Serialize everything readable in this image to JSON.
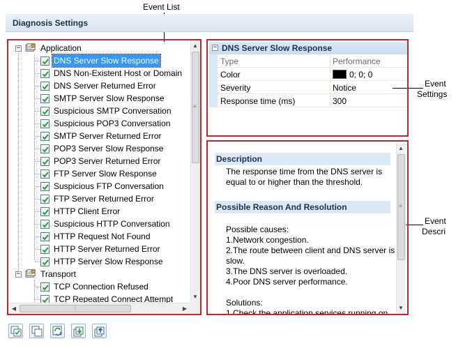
{
  "callouts": {
    "event_list": "Event List",
    "event_settings_line1": "Event",
    "event_settings_line2": "Settings",
    "event_descri_line1": "Event",
    "event_descri_line2": "Descri"
  },
  "header": {
    "title": "Diagnosis Settings"
  },
  "tree": {
    "groups": [
      {
        "label": "Application",
        "items": [
          "DNS Server Slow Response",
          "DNS Non-Existent Host or Domain",
          "DNS Server Returned Error",
          "SMTP Server Slow Response",
          "Suspicious SMTP Conversation",
          "Suspicious POP3 Conversation",
          "SMTP Server Returned Error",
          "POP3 Server Slow Response",
          "POP3 Server Returned Error",
          "FTP Server Slow Response",
          "Suspicious FTP Conversation",
          "FTP Server Returned Error",
          "HTTP Client Error",
          "Suspicious HTTP Conversation",
          "HTTP Request Not Found",
          "HTTP Server Returned Error",
          "HTTP Server Slow Response"
        ]
      },
      {
        "label": "Transport",
        "items": [
          "TCP Connection Refused",
          "TCP Repeated Connect Attempt"
        ]
      }
    ],
    "selected_item": "DNS Server Slow Response"
  },
  "properties": {
    "title": "DNS Server Slow Response",
    "rows": [
      {
        "name": "Type",
        "value": "Performance"
      },
      {
        "name": "Color",
        "value": "0; 0; 0"
      },
      {
        "name": "Severity",
        "value": "Notice"
      },
      {
        "name": "Response time (ms)",
        "value": "300"
      }
    ],
    "color_value": "#000000"
  },
  "description": {
    "section1_title": "Description",
    "section1_text_line1": "The response time from the DNS server is",
    "section1_text_line2": "equal to or higher than the threshold.",
    "section2_title": "Possible Reason And Resolution",
    "causes_heading": "Possible causes:",
    "cause1": "1.Network congestion.",
    "cause2_line1": "2.The route between client and DNS server is",
    "cause2_line2": "slow.",
    "cause3": "3.The DNS server is overloaded.",
    "cause4": "4.Poor DNS server performance.",
    "solutions_heading": "Solutions:",
    "solution1": "1.Check the application services running on"
  },
  "colors": {
    "annotation_frame": "#c0282d",
    "selection": "#3399ff",
    "section_band": "#dbe8f6",
    "check": "#2a9d2a"
  },
  "toolbar": {
    "icons": [
      "check-all-icon",
      "uncheck-all-icon",
      "refresh-icon",
      "import-icon",
      "export-icon"
    ]
  }
}
